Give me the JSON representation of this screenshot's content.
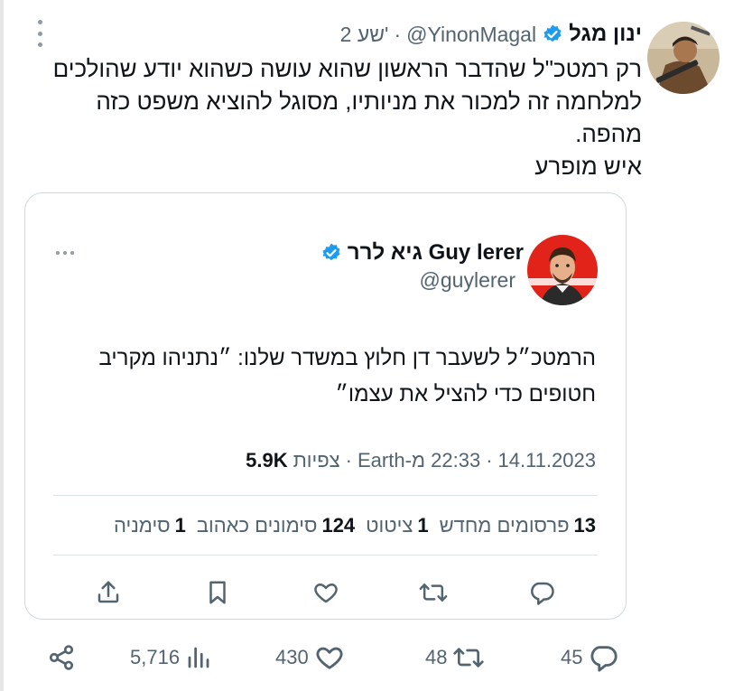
{
  "tweet": {
    "author_name": "ינון מגל",
    "handle": "@YinonMagal",
    "separator": "·",
    "time": "2 שע'",
    "text_lines": [
      "רק רמטכ\"ל שהדבר הראשון שהוא עושה כשהוא יודע שהולכים",
      "למלחמה זה למכור את מניותיו, מסוגל להוציא משפט כזה",
      "מהפה.",
      "איש מופרע"
    ],
    "stats": {
      "replies": "45",
      "retweets": "48",
      "likes": "430",
      "views": "5,716"
    }
  },
  "quoted": {
    "name": "גיא לרר Guy lerer",
    "handle": "@guylerer",
    "text_lines": [
      "הרמטכ״ל לשעבר דן חלוץ במשדר שלנו: ״נתניהו מקריב",
      "חטופים כדי להציל את עצמו״"
    ],
    "meta": {
      "date": "14.11.2023",
      "sep1": "·",
      "time": "22:33 מ-Earth",
      "sep2": "·",
      "views_count": "5.9K",
      "views_label": "צפיות"
    },
    "stats": [
      {
        "count": "13",
        "label": "פרסומים מחדש"
      },
      {
        "count": "1",
        "label": "ציטוט"
      },
      {
        "count": "124",
        "label": "סימונים כאהוב"
      },
      {
        "count": "1",
        "label": "סימניה"
      }
    ]
  },
  "colors": {
    "text_primary": "#0f1419",
    "text_secondary": "#536471",
    "verified": "#1d9bf0",
    "border": "#cfd9de"
  },
  "icons": {
    "verified": "verified-badge-icon",
    "reply": "reply-icon",
    "retweet": "retweet-icon",
    "like": "heart-icon",
    "views": "views-bar-chart-icon",
    "share": "share-icon",
    "bookmark": "bookmark-icon",
    "upload": "upload-icon",
    "more": "more-icon"
  }
}
